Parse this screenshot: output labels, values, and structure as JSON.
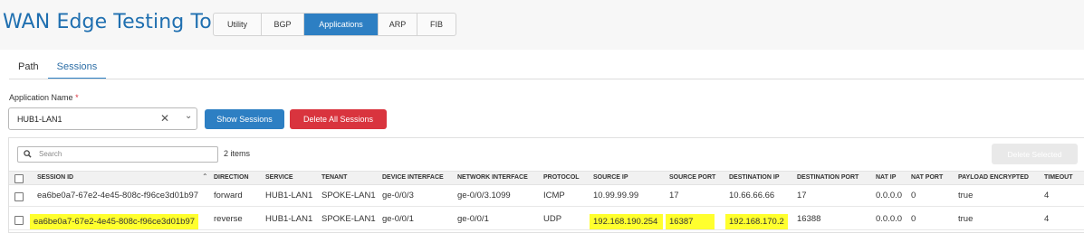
{
  "header": {
    "title": "WAN Edge Testing Tools",
    "tabs": [
      {
        "label": "Utility",
        "active": false
      },
      {
        "label": "BGP",
        "active": false
      },
      {
        "label": "Applications",
        "active": true
      },
      {
        "label": "ARP",
        "active": false
      },
      {
        "label": "FIB",
        "active": false
      }
    ]
  },
  "subtabs": [
    {
      "label": "Path",
      "active": false
    },
    {
      "label": "Sessions",
      "active": true
    }
  ],
  "form": {
    "app_label": "Application Name",
    "required_mark": "*",
    "app_value": "HUB1-LAN1",
    "clear_icon": "✕",
    "chevron_icon": "⌄",
    "show_label": "Show Sessions",
    "delete_all_label": "Delete All Sessions"
  },
  "table": {
    "search_placeholder": "Search",
    "search_icon": "🔍",
    "count": "2 items",
    "delete_selected_label": "Delete Selected",
    "sort_icon": "⌃",
    "columns": [
      "SESSION ID",
      "DIRECTION",
      "SERVICE",
      "TENANT",
      "DEVICE INTERFACE",
      "NETWORK INTERFACE",
      "PROTOCOL",
      "SOURCE IP",
      "SOURCE PORT",
      "DESTINATION IP",
      "DESTINATION PORT",
      "NAT IP",
      "NAT PORT",
      "PAYLOAD ENCRYPTED",
      "TIMEOUT"
    ],
    "rows": [
      [
        "ea6be0a7-67e2-4e45-808c-f96ce3d01b97",
        "forward",
        "HUB1-LAN1",
        "SPOKE-LAN1",
        "ge-0/0/3",
        "ge-0/0/3.1099",
        "ICMP",
        "10.99.99.99",
        "17",
        "10.66.66.66",
        "17",
        "0.0.0.0",
        "0",
        "true",
        "4"
      ],
      [
        "ea6be0a7-67e2-4e45-808c-f96ce3d01b97",
        "reverse",
        "HUB1-LAN1",
        "SPOKE-LAN1",
        "ge-0/0/1",
        "ge-0/0/1",
        "UDP",
        "192.168.190.254",
        "16387",
        "192.168.170.2",
        "16388",
        "0.0.0.0",
        "0",
        "true",
        "4"
      ]
    ],
    "highlight_color": "#ffff2e"
  },
  "colors": {
    "accent": "#2d7fc3",
    "title": "#1f6fb0",
    "danger": "#d9343e"
  }
}
